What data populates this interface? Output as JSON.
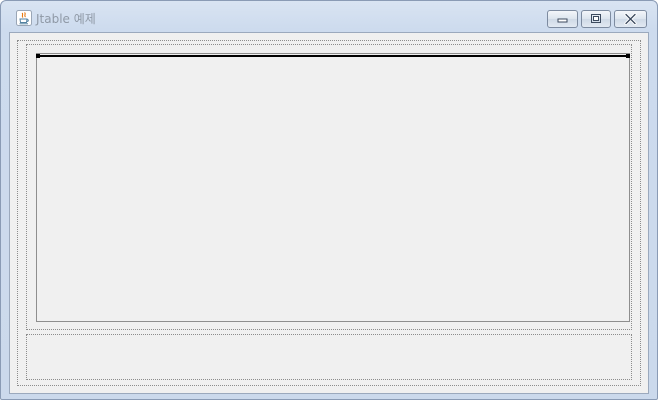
{
  "window": {
    "title": "Jtable 예제",
    "icon": "java-icon"
  },
  "titlebar_buttons": {
    "minimize": "minimize-icon",
    "maximize": "maximize-icon",
    "close": "close-icon"
  },
  "colors": {
    "title_text": "#8f99a6",
    "frame": "#cbd9ec",
    "client_background": "#f0f0f0"
  }
}
